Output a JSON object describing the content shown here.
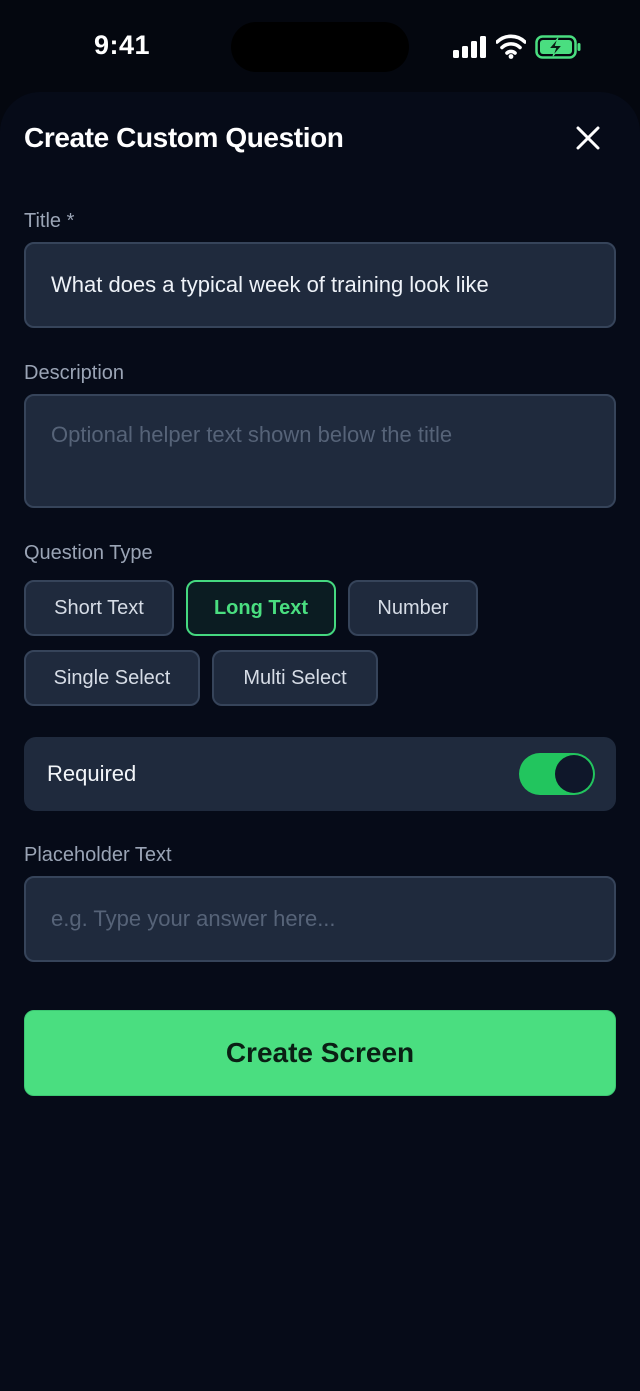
{
  "status_bar": {
    "time": "9:41"
  },
  "header": {
    "title": "Create Custom Question"
  },
  "title_field": {
    "label": "Title *",
    "value": "What does a typical week of training look like"
  },
  "description_field": {
    "label": "Description",
    "placeholder": "Optional helper text shown below the title"
  },
  "question_type": {
    "label": "Question Type",
    "options": [
      "Short Text",
      "Long Text",
      "Number",
      "Single Select",
      "Multi Select"
    ],
    "selected": "Long Text"
  },
  "required_toggle": {
    "label": "Required",
    "on": true
  },
  "placeholder_field": {
    "label": "Placeholder Text",
    "placeholder": "e.g. Type your answer here..."
  },
  "actions": {
    "create_label": "Create Screen"
  },
  "colors": {
    "accent": "#4ade80",
    "background": "#04070f",
    "surface": "#1f2a3d",
    "border": "#36445a"
  },
  "icons": {
    "close": "close-icon",
    "signal": "signal-icon",
    "wifi": "wifi-icon",
    "battery": "battery-charging-icon"
  }
}
